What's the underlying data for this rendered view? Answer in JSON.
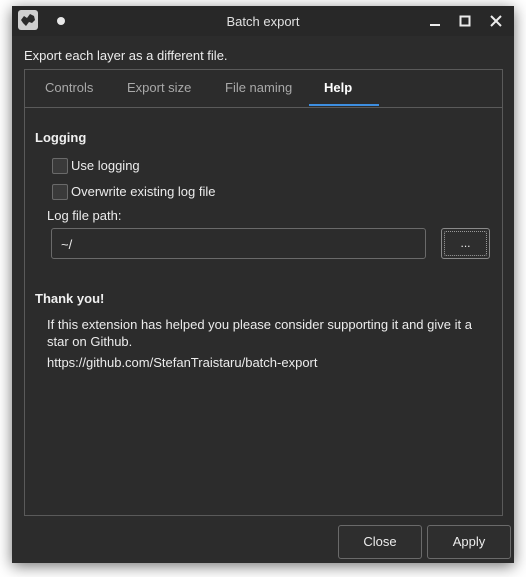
{
  "window": {
    "title": "Batch export"
  },
  "description": "Export each layer as a different file.",
  "tabs": [
    {
      "label": "Controls",
      "active": false
    },
    {
      "label": "Export size",
      "active": false
    },
    {
      "label": "File naming",
      "active": false
    },
    {
      "label": "Help",
      "active": true
    }
  ],
  "logging": {
    "heading": "Logging",
    "use_logging_label": "Use logging",
    "use_logging_checked": false,
    "overwrite_label": "Overwrite existing log file",
    "overwrite_checked": false,
    "path_label": "Log file path:",
    "path_value": "~/",
    "browse_label": "..."
  },
  "thanks": {
    "heading": "Thank you!",
    "line1": "If this extension has helped you please consider supporting it and give it a",
    "line2": "star on Github.",
    "link": "https://github.com/StefanTraistaru/batch-export"
  },
  "buttons": {
    "close": "Close",
    "apply": "Apply"
  },
  "colors": {
    "window_bg": "#2c2c2c",
    "accent": "#3d8ee0"
  }
}
